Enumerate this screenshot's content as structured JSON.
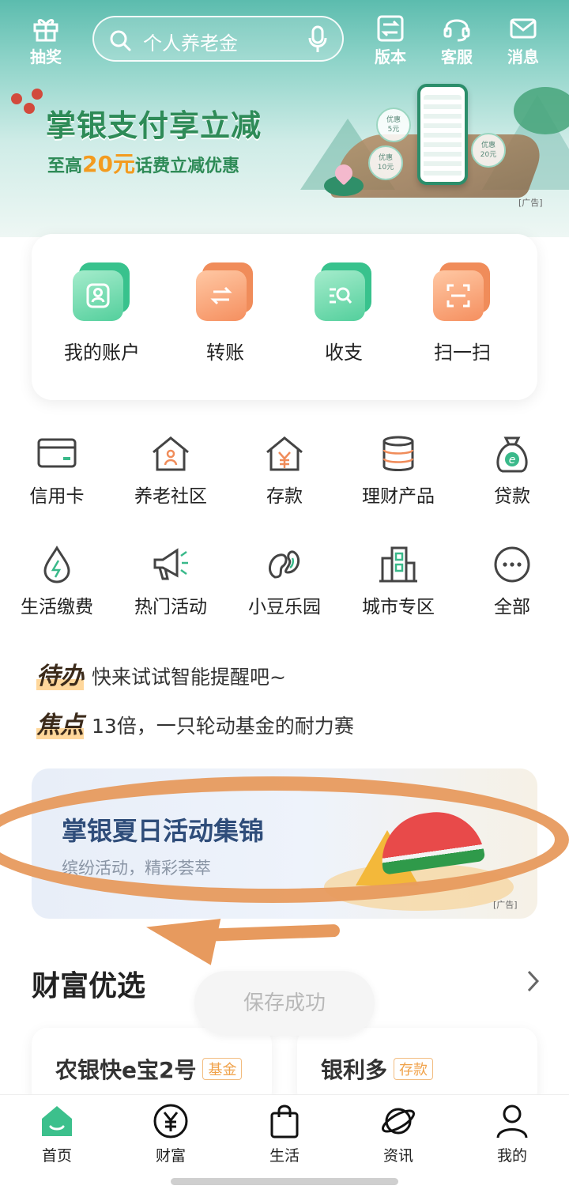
{
  "topbar": {
    "lottery_label": "抽奖",
    "search_placeholder": "个人养老金",
    "version_label": "版本",
    "service_label": "客服",
    "message_label": "消息"
  },
  "promo": {
    "title": "掌银支付享立减",
    "subtitle_prefix": "至高",
    "subtitle_amount": "20元",
    "subtitle_suffix": "话费立减优惠",
    "coupons": [
      "优惠\n5元",
      "优惠\n10元",
      "优惠\n20元"
    ],
    "ad_tag": "[广告]"
  },
  "quick_actions": [
    {
      "label": "我的账户",
      "icon": "account-icon",
      "color": "green"
    },
    {
      "label": "转账",
      "icon": "transfer-icon",
      "color": "orange"
    },
    {
      "label": "收支",
      "icon": "ledger-search-icon",
      "color": "green"
    },
    {
      "label": "扫一扫",
      "icon": "scan-icon",
      "color": "orange"
    }
  ],
  "grid": [
    {
      "label": "信用卡",
      "icon": "credit-card-icon"
    },
    {
      "label": "养老社区",
      "icon": "elder-home-icon"
    },
    {
      "label": "存款",
      "icon": "deposit-house-icon"
    },
    {
      "label": "理财产品",
      "icon": "coin-stack-icon"
    },
    {
      "label": "贷款",
      "icon": "loan-bag-icon"
    },
    {
      "label": "生活缴费",
      "icon": "water-drop-icon"
    },
    {
      "label": "热门活动",
      "icon": "megaphone-icon"
    },
    {
      "label": "小豆乐园",
      "icon": "bean-icon"
    },
    {
      "label": "城市专区",
      "icon": "city-building-icon"
    },
    {
      "label": "全部",
      "icon": "more-dots-icon"
    }
  ],
  "todo": {
    "tag": "待办",
    "text": "快来试试智能提醒吧~"
  },
  "focus": {
    "tag": "焦点",
    "text": "13倍，一只轮动基金的耐力赛"
  },
  "summer_banner": {
    "title": "掌银夏日活动集锦",
    "subtitle": "缤纷活动，精彩荟萃",
    "ad_tag": "[广告]"
  },
  "wealth": {
    "title": "财富优选",
    "cards": [
      {
        "name": "农银快e宝2号",
        "badge": "基金"
      },
      {
        "name": "银利多",
        "badge": "存款"
      }
    ]
  },
  "toast": "保存成功",
  "tabbar": [
    {
      "label": "首页",
      "icon": "home-icon",
      "active": true
    },
    {
      "label": "财富",
      "icon": "yen-icon",
      "active": false
    },
    {
      "label": "生活",
      "icon": "shopping-bag-icon",
      "active": false
    },
    {
      "label": "资讯",
      "icon": "planet-icon",
      "active": false
    },
    {
      "label": "我的",
      "icon": "profile-icon",
      "active": false
    }
  ],
  "colors": {
    "brand_green": "#38c28d",
    "accent_orange": "#f08c5a",
    "annotation_orange": "#e79a5e"
  }
}
